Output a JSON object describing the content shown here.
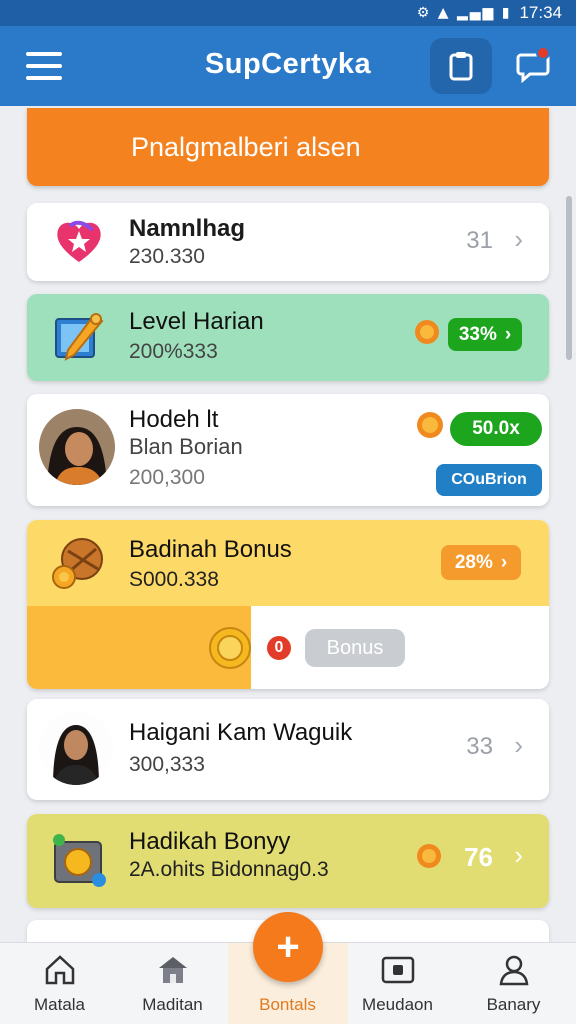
{
  "status_bar": {
    "time": "17:34",
    "icons": "⚙ ▲ ▂▄▆ ▮"
  },
  "app_bar": {
    "title": "SupCertyka",
    "notification_dot": true
  },
  "banner": {
    "text": "Pnalgmalberi alsen",
    "color": "#f4821e"
  },
  "cards": [
    {
      "title": "Namnlhag",
      "subtitle": "230.330",
      "count": "31",
      "icon": "heart-star-icon"
    },
    {
      "title": "Level Harian",
      "subtitle": "200%333",
      "icon": "pencil-tablet-icon",
      "coin_icon": "coin-icon",
      "badge": "33%",
      "badge_color": "#1ea51e"
    },
    {
      "title": "Hodeh lt",
      "subtitle": "Blan Borian",
      "detail": "200,300",
      "coin_icon": "coin-icon",
      "badge": "50.0x",
      "badge_color": "#1ea51e",
      "button": "COuBrion",
      "button_color": "#2180c5"
    },
    {
      "title": "Badinah Bonus",
      "subtitle": "S000.338",
      "icon": "treasure-coins-icon",
      "badge": "28%",
      "badge_color": "#f59a2c",
      "progress_count": "0",
      "bonus_button": "Bonus",
      "progress": 0.43
    },
    {
      "title": "Haigani Kam Waguik",
      "subtitle": "300,333",
      "count": "33"
    },
    {
      "title": "Hadikah Bonyy",
      "subtitle": "2A.ohits Bidonnag0.3",
      "icon": "wallet-icon",
      "coin_icon": "coin-icon",
      "count": "76"
    }
  ],
  "bottom_nav": [
    {
      "label": "Matala",
      "icon": "home-icon"
    },
    {
      "label": "Maditan",
      "icon": "store-icon"
    },
    {
      "label": "Bontals",
      "icon": "plus-icon"
    },
    {
      "label": "Meudaon",
      "icon": "media-icon"
    },
    {
      "label": "Banary",
      "icon": "profile-icon"
    }
  ],
  "colors": {
    "primary": "#2a7ac9",
    "status_bar": "#1f5fa6",
    "accent": "#f47a1c",
    "green_card": "#9ee0bb",
    "yellow_card": "#fdd968",
    "olive_card": "#e2dd72"
  }
}
